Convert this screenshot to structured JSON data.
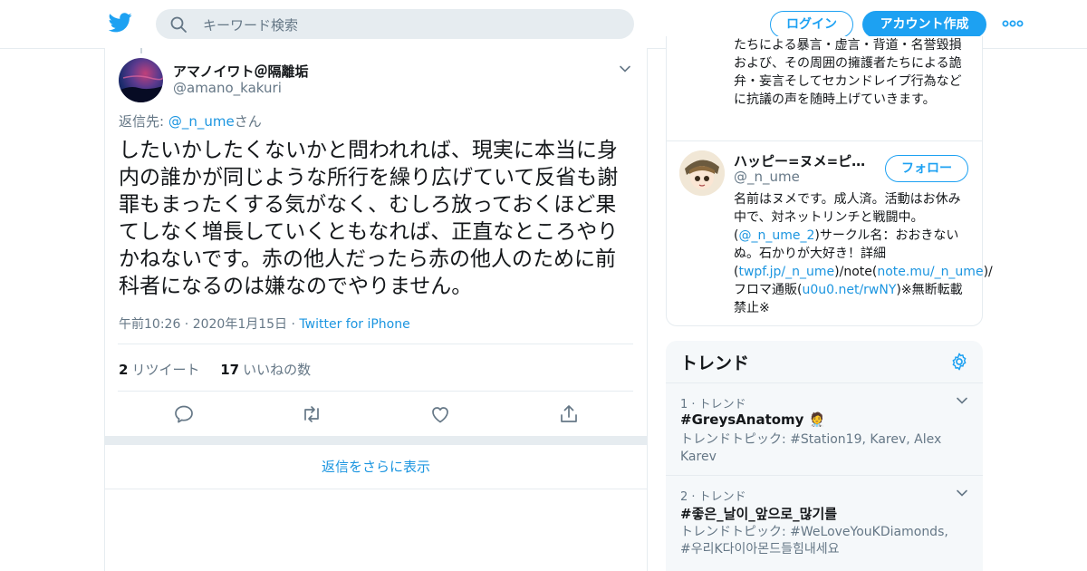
{
  "header": {
    "search_placeholder": "キーワード検索",
    "login_label": "ログイン",
    "signup_label": "アカウント作成"
  },
  "tweet": {
    "author_name": "アマノイワト＠隔離垢",
    "author_handle": "@amano_kakuri",
    "reply_prefix": "返信先: ",
    "reply_to": "@_n_ume",
    "reply_suffix": "さん",
    "text": "したいかしたくないかと問われれば、現実に本当に身内の誰かが同じような所行を繰り広げていて反省も謝罪もまったくする気がなく、むしろ放っておくほど果てしなく増長していくともなれば、正直なところやりかねないです。赤の他人だったら赤の他人のために前科者になるのは嫌なのでやりません。",
    "timestamp": "午前10:26 · 2020年1月15日",
    "meta_sep": " · ",
    "via": "Twitter for iPhone",
    "retweet_count": "2",
    "retweet_label": "リツイート",
    "like_count": "17",
    "like_label": "いいねの数"
  },
  "show_more_replies": "返信をさらに表示",
  "sidebar": {
    "bio_top": "たちによる暴言・虚言・背道・名誉毀損および、その周囲の擁護者たちによる詭弁・妄言そしてセカンドレイプ行為などに抗議の声を随時上げていきます。",
    "user": {
      "name": "ハッピー=ヌメ=ピギ…",
      "handle": "@_n_ume",
      "follow_label": "フォロー",
      "bio_1": "名前はヌメです。成人済。活動はお休み中で、対ネットリンチと戦闘中。(",
      "bio_link_1": "@_n_ume_2",
      "bio_2": ")サークル名：おおきないぬ。石かりが大好き！詳細(",
      "bio_link_2": "twpf.jp/_n_ume",
      "bio_3": ")/note(",
      "bio_link_3": "note.mu/_n_ume",
      "bio_4": ")/フロマ通販(",
      "bio_link_4": "u0u0.net/rwNY",
      "bio_5": ")※無断転載禁止※"
    },
    "trends": {
      "title": "トレンド",
      "items": [
        {
          "rank": "1 · トレンド",
          "tag": "#GreysAnatomy 🧑‍⚕️",
          "desc": "トレンドトピック: #Station19, Karev, Alex Karev"
        },
        {
          "rank": "2 · トレンド",
          "tag": "#좋은_날이_앞으로_많기를",
          "desc": "トレンドトピック: #WeLoveYouKDiamonds, #우리K다이아몬드들힘내세요"
        }
      ]
    }
  },
  "colors": {
    "accent": "#1da1f2",
    "link": "#1b95e0",
    "secondary_text": "#657786",
    "border": "#e6ecf0"
  },
  "icons": [
    "twitter-bird-icon",
    "search-icon",
    "more-dots-icon",
    "chevron-down-icon",
    "reply-icon",
    "retweet-icon",
    "like-heart-icon",
    "share-icon",
    "gear-icon"
  ]
}
